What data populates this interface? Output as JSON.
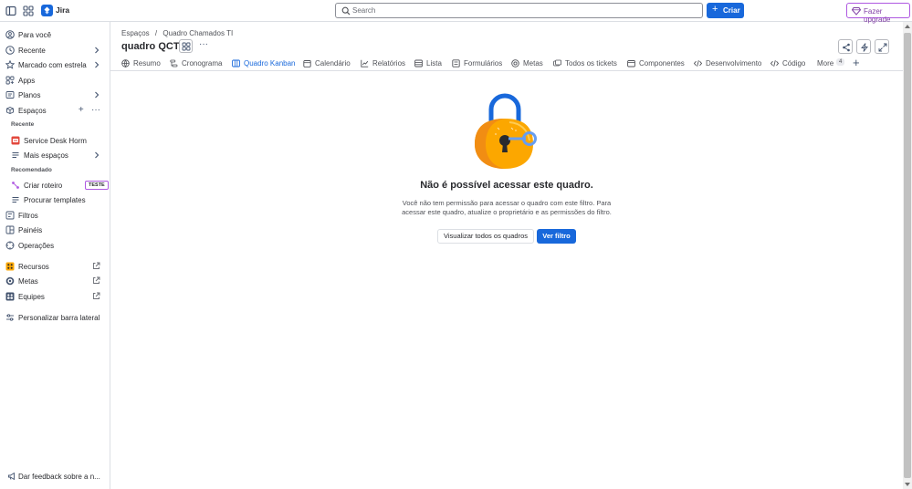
{
  "topbar": {
    "app_name": "Jira",
    "search_placeholder": "Search",
    "create_label": "Criar",
    "upgrade_label": "Fazer upgrade"
  },
  "sidebar": {
    "items": [
      {
        "label": "Para você",
        "icon": "person-circle-icon"
      },
      {
        "label": "Recente",
        "icon": "clock-icon"
      },
      {
        "label": "Marcado com estrela",
        "icon": "star-icon"
      },
      {
        "label": "Apps",
        "icon": "apps-icon"
      },
      {
        "label": "Planos",
        "icon": "planos-icon"
      },
      {
        "label": "Espaços",
        "icon": "spaces-icon"
      }
    ],
    "recent_header": "Recente",
    "recent_space": "Service Desk Horm",
    "more_spaces": "Mais espaços",
    "recommended_header": "Recomendado",
    "create_roadmap": "Criar roteiro",
    "create_roadmap_badge": "TESTE",
    "browse_templates": "Procurar templates",
    "bottom_items": [
      {
        "label": "Filtros",
        "icon": "filter-icon"
      },
      {
        "label": "Painéis",
        "icon": "dashboard-icon"
      },
      {
        "label": "Operações",
        "icon": "operations-icon"
      }
    ],
    "external_items": [
      {
        "label": "Recursos"
      },
      {
        "label": "Metas"
      },
      {
        "label": "Equipes"
      }
    ],
    "customize": "Personalizar barra lateral",
    "feedback": "Dar feedback sobre a n..."
  },
  "header": {
    "breadcrumb": [
      "Espaços",
      "/",
      "Quadro Chamados TI"
    ],
    "title": "quadro QCT"
  },
  "tabs": [
    {
      "label": "Resumo"
    },
    {
      "label": "Cronograma"
    },
    {
      "label": "Quadro Kanban",
      "active": true
    },
    {
      "label": "Calendário"
    },
    {
      "label": "Relatórios"
    },
    {
      "label": "Lista"
    },
    {
      "label": "Formulários"
    },
    {
      "label": "Metas"
    },
    {
      "label": "Todos os tickets"
    },
    {
      "label": "Componentes"
    },
    {
      "label": "Desenvolvimento"
    },
    {
      "label": "Código"
    }
  ],
  "more_tab": {
    "label": "More",
    "count": "4"
  },
  "empty_state": {
    "title": "Não é possível acessar este quadro.",
    "description": "Você não tem permissão para acessar o quadro com este filtro. Para acessar este quadro, atualize o proprietário e as permissões do filtro.",
    "secondary_button": "Visualizar todos os quadros",
    "primary_button": "Ver filtro"
  },
  "colors": {
    "accent": "#1868db",
    "upgrade": "#803fa5",
    "lock_body": "#fca700",
    "lock_shackle": "#1868db"
  }
}
